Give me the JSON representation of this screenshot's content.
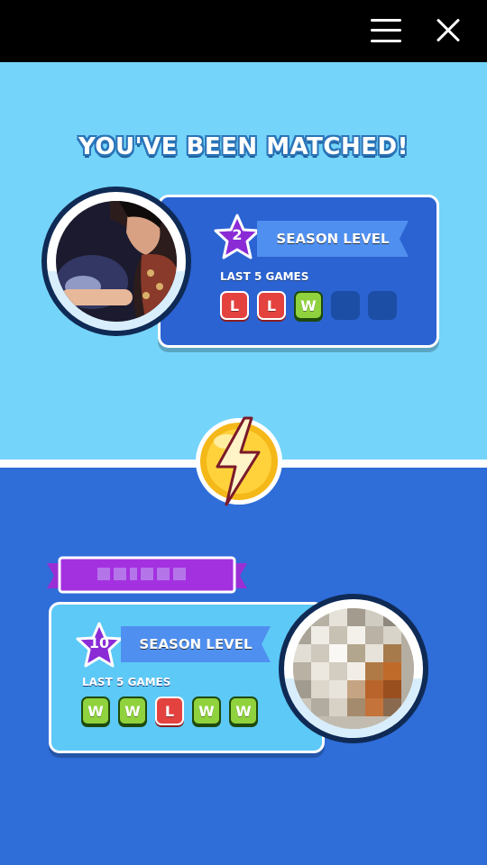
{
  "colors": {
    "top_bg": "#75d4fa",
    "bottom_bg": "#2f6dd8",
    "card_top": "#2b63d2",
    "card_bottom": "#5dc9f6",
    "star": "#8a2bd6",
    "loss": "#e3423f",
    "win": "#8fd23d"
  },
  "icons": {
    "menu": "hamburger-icon",
    "close": "close-icon",
    "versus": "lightning-bolt-icon"
  },
  "headline": "YOU'VE BEEN MATCHED!",
  "player_top": {
    "level": "2",
    "season_label": "SEASON LEVEL",
    "last_games_label": "LAST 5 GAMES",
    "games": [
      "L",
      "L",
      "W",
      "",
      ""
    ]
  },
  "player_bottom": {
    "level": "10",
    "season_label": "SEASON LEVEL",
    "last_games_label": "LAST 5 GAMES",
    "games": [
      "W",
      "W",
      "L",
      "W",
      "W"
    ]
  }
}
